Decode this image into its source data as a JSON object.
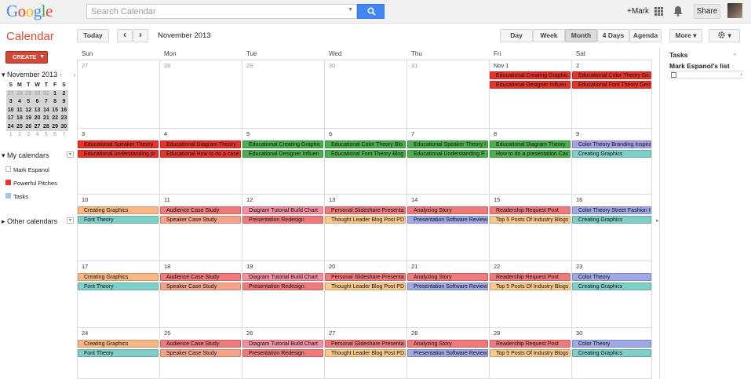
{
  "header": {
    "logo": "Google",
    "search_placeholder": "Search Calendar",
    "user": "+Mark",
    "share": "Share"
  },
  "app_title": "Calendar",
  "toolbar": {
    "today": "Today",
    "prev": "‹",
    "next": "›",
    "current": "November 2013",
    "views": [
      "Day",
      "Week",
      "Month",
      "4 Days",
      "Agenda"
    ],
    "more": "More ▾",
    "settings_arrow": "▾"
  },
  "create_label": "CREATE",
  "mini": {
    "title": "November 2013",
    "nav": "‹ ›",
    "dows": [
      "S",
      "M",
      "T",
      "W",
      "T",
      "F",
      "S"
    ],
    "weeks": [
      [
        "27",
        "28",
        "29",
        "30",
        "31",
        "1",
        "2"
      ],
      [
        "3",
        "4",
        "5",
        "6",
        "7",
        "8",
        "9"
      ],
      [
        "10",
        "11",
        "12",
        "13",
        "14",
        "15",
        "16"
      ],
      [
        "17",
        "18",
        "19",
        "20",
        "21",
        "22",
        "23"
      ],
      [
        "24",
        "25",
        "26",
        "27",
        "28",
        "29",
        "30"
      ],
      [
        "1",
        "2",
        "3",
        "4",
        "5",
        "6",
        "7"
      ]
    ]
  },
  "my_calendars": {
    "title": "My calendars",
    "items": [
      "Mark Espanol",
      "Powerful Pitches",
      "Tasks"
    ]
  },
  "other_calendars": "Other calendars",
  "colors": {
    "red": "#e8332a",
    "green": "#4caf50",
    "blue": "#a7a2e6",
    "orange": "#f9b883",
    "pink": "#f07a7a",
    "salmon": "#f4a389",
    "rose": "#f48fa0",
    "peach": "#f9c98c",
    "periwinkle": "#9ea9e6",
    "teal": "#7fcfc9"
  },
  "dow": [
    "Sun",
    "Mon",
    "Tue",
    "Wed",
    "Thu",
    "Fri",
    "Sat"
  ],
  "weeks": [
    {
      "days": [
        "27",
        "28",
        "29",
        "30",
        "31",
        "Nov 1",
        "2"
      ],
      "outside": [
        0,
        1,
        2,
        3,
        4
      ],
      "events": [
        [
          5,
          0,
          "Educational Creating Graphic",
          "red"
        ],
        [
          6,
          0,
          "Educational Color Theory Ge",
          "red"
        ],
        [
          5,
          1,
          "Educational Designer Influen",
          "red"
        ],
        [
          6,
          1,
          "Educational Font Theory Gen",
          "red"
        ]
      ]
    },
    {
      "days": [
        "3",
        "4",
        "5",
        "6",
        "7",
        "8",
        "9"
      ],
      "events": [
        [
          0,
          0,
          "Educational Speaker Theory",
          "red"
        ],
        [
          1,
          0,
          "Educational Diagram Theory",
          "red"
        ],
        [
          2,
          0,
          "Educational Creating Graphic",
          "green"
        ],
        [
          3,
          0,
          "Educational Color Theory Blo",
          "green"
        ],
        [
          4,
          0,
          "Educational Speaker Theory I",
          "green"
        ],
        [
          5,
          0,
          "Educational Diagram Theory",
          "green"
        ],
        [
          6,
          0,
          "Color Theory Branding Inspira",
          "blue"
        ],
        [
          0,
          1,
          "Educational understanding pr",
          "red"
        ],
        [
          1,
          1,
          "Educational How to do a case",
          "red"
        ],
        [
          2,
          1,
          "Educational Designer Influen",
          "green"
        ],
        [
          3,
          1,
          "Educational Font Theory Blog",
          "green"
        ],
        [
          4,
          1,
          "Educational Understanding P.",
          "green"
        ],
        [
          5,
          1,
          "How to do a presentation Cas",
          "green"
        ],
        [
          6,
          1,
          "Creating Graphics",
          "teal"
        ]
      ]
    },
    {
      "days": [
        "10",
        "11",
        "12",
        "13",
        "14",
        "15",
        "16"
      ],
      "events": [
        [
          0,
          0,
          "Creating Graphics",
          "orange"
        ],
        [
          1,
          0,
          "Audience Case Study",
          "pink"
        ],
        [
          2,
          0,
          "Diagram Tutorial Build Chart",
          "rose"
        ],
        [
          3,
          0,
          "Personal Slideshare Presenta",
          "pink"
        ],
        [
          4,
          0,
          "Analyzing Story",
          "pink"
        ],
        [
          5,
          0,
          "Readership Request Post",
          "pink"
        ],
        [
          6,
          0,
          "Color Theory Street Fashion I",
          "periwinkle"
        ],
        [
          0,
          1,
          "Font Theory",
          "teal"
        ],
        [
          1,
          1,
          "Speaker Case Study",
          "salmon"
        ],
        [
          2,
          1,
          "Presentation Redesign",
          "pink"
        ],
        [
          3,
          1,
          "Thought Leader Blog Post PD",
          "peach"
        ],
        [
          4,
          1,
          "Presentation Software Review",
          "periwinkle"
        ],
        [
          5,
          1,
          "Top 5 Posts Of Industry Blogs",
          "peach"
        ],
        [
          6,
          1,
          "Creating Graphics",
          "teal"
        ]
      ]
    },
    {
      "days": [
        "17",
        "18",
        "19",
        "20",
        "21",
        "22",
        "23"
      ],
      "events": [
        [
          0,
          0,
          "Creating Graphics",
          "orange"
        ],
        [
          1,
          0,
          "Audience Case Study",
          "pink"
        ],
        [
          2,
          0,
          "Diagram Tutorial Build Chart",
          "rose"
        ],
        [
          3,
          0,
          "Personal Slideshare Presenta",
          "pink"
        ],
        [
          4,
          0,
          "Analyzing Story",
          "pink"
        ],
        [
          5,
          0,
          "Readership Request Post",
          "pink"
        ],
        [
          6,
          0,
          "Color Theory",
          "periwinkle"
        ],
        [
          0,
          1,
          "Font Theory",
          "teal"
        ],
        [
          1,
          1,
          "Speaker Case Study",
          "salmon"
        ],
        [
          2,
          1,
          "Presentation Redesign",
          "pink"
        ],
        [
          3,
          1,
          "Thought Leader Blog Post PD",
          "peach"
        ],
        [
          4,
          1,
          "Presentation Software Review",
          "periwinkle"
        ],
        [
          5,
          1,
          "Top 5 Posts Of Industry Blogs",
          "peach"
        ],
        [
          6,
          1,
          "Creating Graphics",
          "teal"
        ]
      ]
    },
    {
      "days": [
        "24",
        "25",
        "26",
        "27",
        "28",
        "29",
        "30"
      ],
      "events": [
        [
          0,
          0,
          "Creating Graphics",
          "orange"
        ],
        [
          1,
          0,
          "Audience Case Study",
          "pink"
        ],
        [
          2,
          0,
          "Diagram Tutorial Build Chart",
          "rose"
        ],
        [
          3,
          0,
          "Personal Slideshare Presenta",
          "pink"
        ],
        [
          4,
          0,
          "Analyzing Story",
          "pink"
        ],
        [
          5,
          0,
          "Readership Request Post",
          "pink"
        ],
        [
          6,
          0,
          "Color Theory",
          "periwinkle"
        ],
        [
          0,
          1,
          "Font Theory",
          "teal"
        ],
        [
          1,
          1,
          "Speaker Case Study",
          "salmon"
        ],
        [
          2,
          1,
          "Presentation Redesign",
          "pink"
        ],
        [
          3,
          1,
          "Thought Leader Blog Post PD",
          "peach"
        ],
        [
          4,
          1,
          "Presentation Software Review",
          "periwinkle"
        ],
        [
          5,
          1,
          "Top 5 Posts Of Industry Blogs",
          "peach"
        ],
        [
          6,
          1,
          "Creating Graphics",
          "teal"
        ]
      ]
    }
  ],
  "tasks": {
    "title": "Tasks",
    "close": "×",
    "list_name": "Mark Espanol's list",
    "chev": "›"
  }
}
